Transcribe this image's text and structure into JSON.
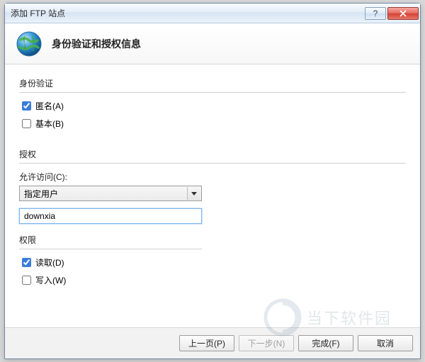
{
  "window": {
    "title": "添加 FTP 站点"
  },
  "header": {
    "heading": "身份验证和授权信息"
  },
  "auth": {
    "section_label": "身份验证",
    "anonymous_label": "匿名(A)",
    "anonymous_checked": true,
    "basic_label": "基本(B)",
    "basic_checked": false
  },
  "authorization": {
    "section_label": "授权",
    "allow_access_label": "允许访问(C):",
    "dropdown_selected": "指定用户",
    "user_input_value": "downxia"
  },
  "permissions": {
    "section_label": "权限",
    "read_label": "读取(D)",
    "read_checked": true,
    "write_label": "写入(W)",
    "write_checked": false
  },
  "footer": {
    "prev_label": "上一页(P)",
    "next_label": "下一步(N)",
    "finish_label": "完成(F)",
    "cancel_label": "取消"
  },
  "watermark": {
    "text": "当下软件园"
  }
}
